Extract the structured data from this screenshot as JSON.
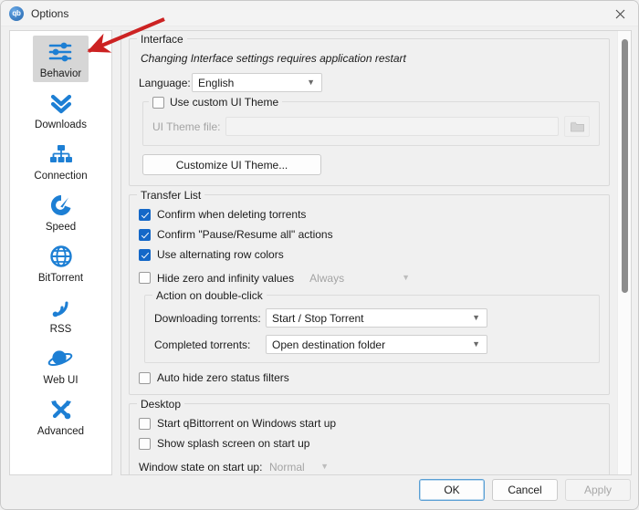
{
  "window": {
    "title": "Options",
    "logo_text": "qb",
    "logo_icon": "qbittorrent-logo-icon",
    "close_icon": "close-icon"
  },
  "sidebar": {
    "items": [
      {
        "label": "Behavior",
        "icon": "sliders-icon",
        "selected": true
      },
      {
        "label": "Downloads",
        "icon": "double-chevron-down-icon",
        "selected": false
      },
      {
        "label": "Connection",
        "icon": "network-nodes-icon",
        "selected": false
      },
      {
        "label": "Speed",
        "icon": "speedometer-icon",
        "selected": false
      },
      {
        "label": "BitTorrent",
        "icon": "globe-icon",
        "selected": false
      },
      {
        "label": "RSS",
        "icon": "rss-feed-icon",
        "selected": false
      },
      {
        "label": "Web UI",
        "icon": "planet-icon",
        "selected": false
      },
      {
        "label": "Advanced",
        "icon": "wrench-screwdriver-icon",
        "selected": false
      }
    ]
  },
  "interface": {
    "title": "Interface",
    "restart_note": "Changing Interface settings requires application restart",
    "language_label": "Language:",
    "language_value": "English",
    "custom_theme_label": "Use custom UI Theme",
    "custom_theme_checked": false,
    "theme_file_label": "UI Theme file:",
    "theme_file_value": "",
    "browse_icon": "folder-icon",
    "customize_button": "Customize UI Theme..."
  },
  "transfer_list": {
    "title": "Transfer List",
    "checkboxes": [
      {
        "label": "Confirm when deleting torrents",
        "checked": true
      },
      {
        "label": "Confirm \"Pause/Resume all\" actions",
        "checked": true
      },
      {
        "label": "Use alternating row colors",
        "checked": true
      }
    ],
    "hide_zero_label": "Hide zero and infinity values",
    "hide_zero_checked": false,
    "hide_zero_value": "Always",
    "double_click": {
      "title": "Action on double-click",
      "downloading_label": "Downloading torrents:",
      "downloading_value": "Start / Stop Torrent",
      "completed_label": "Completed torrents:",
      "completed_value": "Open destination folder"
    },
    "auto_hide_label": "Auto hide zero status filters",
    "auto_hide_checked": false
  },
  "desktop": {
    "title": "Desktop",
    "start_on_windows_label": "Start qBittorrent on Windows start up",
    "start_on_windows_checked": false,
    "splash_label": "Show splash screen on start up",
    "splash_checked": false,
    "window_state_label": "Window state on start up:",
    "window_state_value": "Normal"
  },
  "buttons": {
    "ok": "OK",
    "cancel": "Cancel",
    "apply": "Apply"
  },
  "annotation": {
    "arrow_color": "#cc2222",
    "arrow_name": "red-pointer-arrow"
  }
}
